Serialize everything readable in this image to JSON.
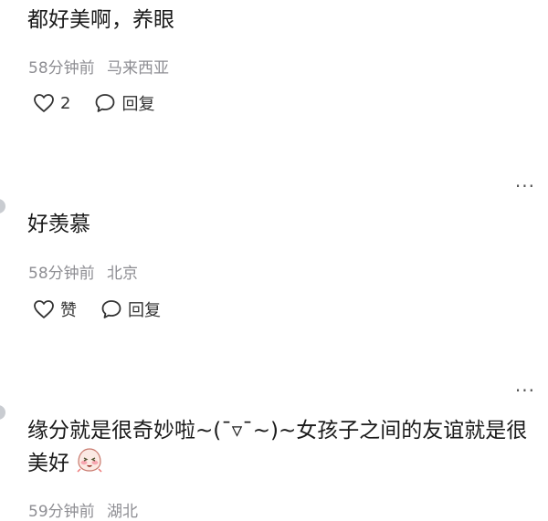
{
  "comments": [
    {
      "text": "都好美啊，养眼",
      "time": "58分钟前",
      "location": "马来西亚",
      "like_label": "2",
      "reply_label": "回复"
    },
    {
      "text": "好羡慕",
      "time": "58分钟前",
      "location": "北京",
      "like_label": "赞",
      "reply_label": "回复"
    },
    {
      "text": "缘分就是很奇妙啦~(¯▿¯~)~女孩子之间的友谊就是很美好",
      "time": "59分钟前",
      "location": "湖北"
    }
  ],
  "more_label": "···",
  "icons": {
    "like": "heart-outline-icon",
    "reply": "speech-bubble-icon",
    "emoji": "blushing-face-emoji-icon"
  },
  "colors": {
    "meta": "#8e8e93",
    "text": "#1a1a1a",
    "emoji_blush": "#f7a6b0"
  }
}
